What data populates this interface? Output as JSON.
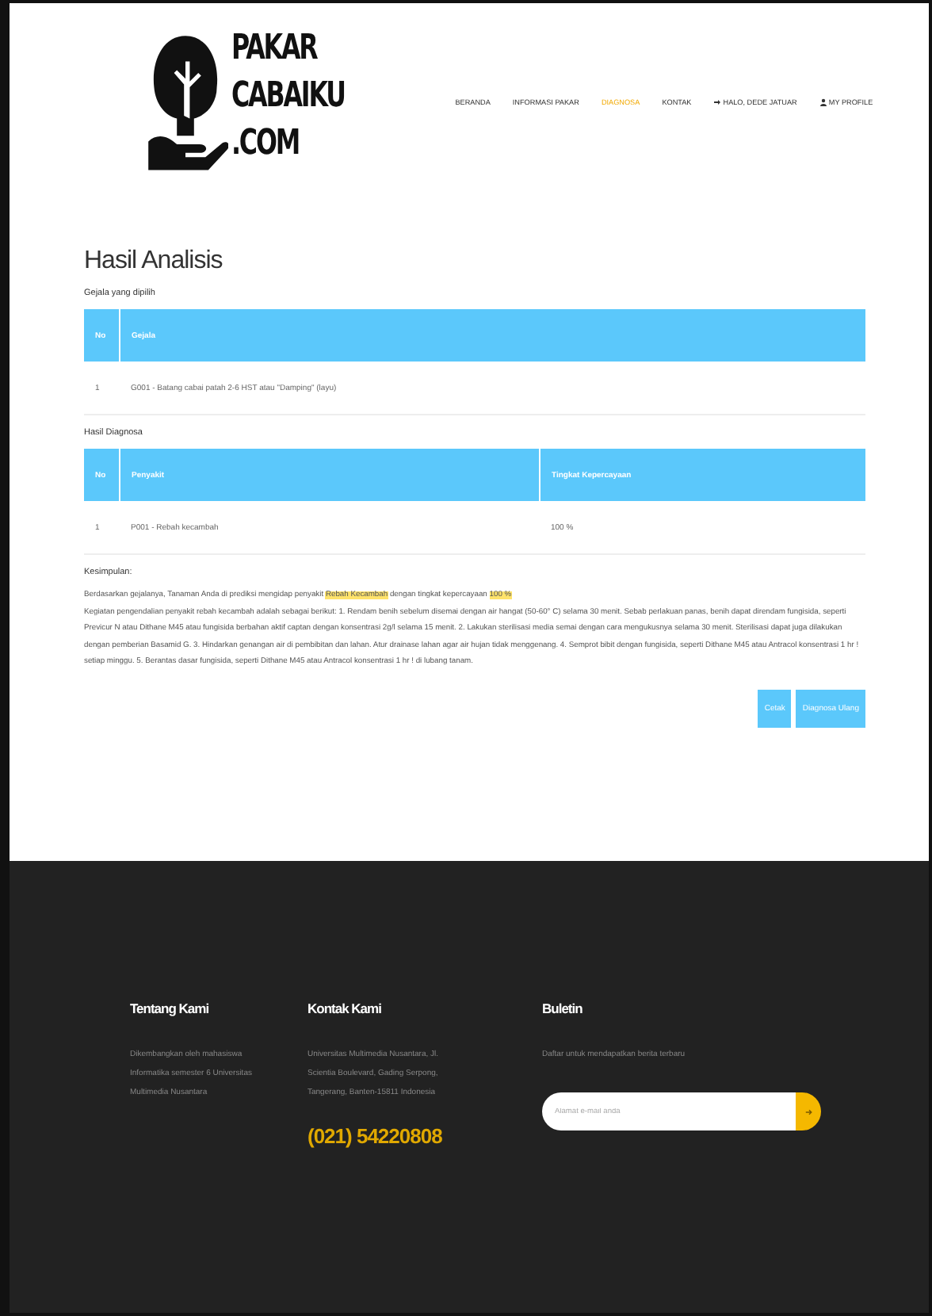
{
  "logo": {
    "lines": [
      "PAKAR",
      "CABAIKU",
      ".COM"
    ]
  },
  "nav": [
    {
      "label": "BERANDA",
      "kind": "link",
      "selected": false
    },
    {
      "label": "INFORMASI PAKAR",
      "kind": "link",
      "selected": false
    },
    {
      "label": "DIAGNOSA",
      "kind": "link",
      "selected": true
    },
    {
      "label": "KONTAK",
      "kind": "link",
      "selected": false
    },
    {
      "label": "HALO, DEDE JATUAR",
      "kind": "signin",
      "selected": false
    },
    {
      "label": "MY PROFILE",
      "kind": "profile",
      "selected": false
    }
  ],
  "title": "Hasil Analisis",
  "symptoms": {
    "heading": "Gejala yang dipilih",
    "columns": [
      "No",
      "Gejala"
    ],
    "rows": [
      [
        "1",
        "G001 - Batang cabai patah 2-6 HST atau \"Damping\" (layu)"
      ]
    ]
  },
  "diagnosis": {
    "heading": "Hasil Diagnosa",
    "columns": [
      "No",
      "Penyakit",
      "Tingkat Kepercayaan"
    ],
    "rows": [
      [
        "1",
        "P001 - Rebah kecambah",
        "100 %"
      ]
    ]
  },
  "conclusion": {
    "heading": "Kesimpulan:",
    "summary": [
      {
        "kind": "plain",
        "text": "Berdasarkan gejalanya, Tanaman Anda di prediksi mengidap penyakit "
      },
      {
        "kind": "highlight",
        "text": "Rebah Kecambah"
      },
      {
        "kind": "plain",
        "text": " dengan tingkat kepercayaan "
      },
      {
        "kind": "highlight",
        "text": "100 %"
      }
    ],
    "treatment": "Kegiatan pengendalian penyakit rebah kecambah adalah sebagai berikut: 1. Rendam benih sebelum disemai dengan air hangat (50-60° C) selama 30 menit. Sebab perlakuan panas, benih dapat direndam fungisida, seperti Previcur N atau Dithane M45 atau fungisida berbahan aktif captan dengan konsentrasi 2g/l selama 15 menit. 2. Lakukan sterilisasi media semai dengan cara mengukusnya selama 30 menit. Sterilisasi dapat juga dilakukan dengan pemberian Basamid G. 3. Hindarkan genangan air di pembibitan dan lahan. Atur drainase lahan agar air hujan tidak menggenang. 4. Semprot bibit dengan fungisida, seperti Dithane M45 atau Antracol konsentrasi 1 hr ! setiap minggu. 5. Berantas dasar fungisida, seperti Dithane M45 atau Antracol konsentrasi 1 hr ! di lubang tanam."
  },
  "actions": [
    "Cetak",
    "Diagnosa Ulang"
  ],
  "footer": {
    "about": {
      "heading": "Tentang Kami",
      "text": "Dikembangkan oleh mahasiswa Informatika semester 6 Universitas Multimedia Nusantara"
    },
    "contact": {
      "heading": "Kontak Kami",
      "text": "Universitas Multimedia Nusantara, Jl. Scientia Boulevard, Gading Serpong, Tangerang, Banten-15811 Indonesia",
      "phone": "(021) 54220808"
    },
    "newsletter": {
      "heading": "Buletin",
      "text": "Daftar untuk mendapatkan berita terbaru",
      "placeholder": "Alamat e-mail anda"
    }
  }
}
